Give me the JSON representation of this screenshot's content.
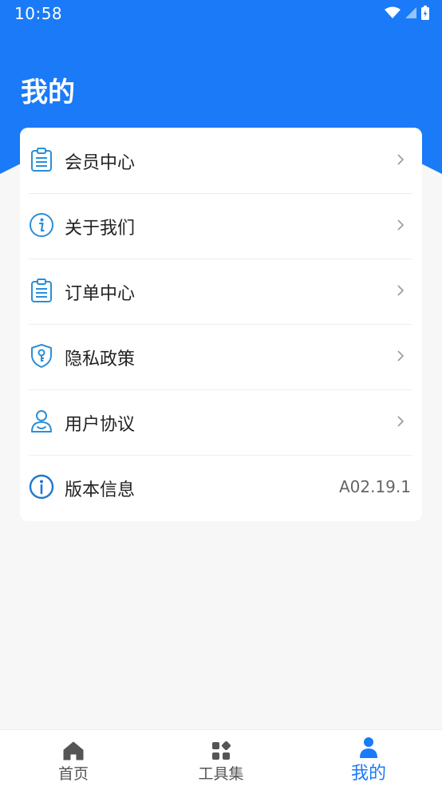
{
  "status_bar": {
    "time": "10:58"
  },
  "page": {
    "title": "我的"
  },
  "menu": {
    "items": [
      {
        "label": "会员中心",
        "icon": "clipboard-icon"
      },
      {
        "label": "关于我们",
        "icon": "info-icon"
      },
      {
        "label": "订单中心",
        "icon": "clipboard-icon"
      },
      {
        "label": "隐私政策",
        "icon": "shield-key-icon"
      },
      {
        "label": "用户协议",
        "icon": "user-icon"
      }
    ],
    "version": {
      "label": "版本信息",
      "value": "A02.19.1",
      "icon": "info-icon"
    }
  },
  "bottom_nav": {
    "items": [
      {
        "label": "首页",
        "icon": "home-icon"
      },
      {
        "label": "工具集",
        "icon": "grid-icon"
      },
      {
        "label": "我的",
        "icon": "person-icon",
        "active": true
      }
    ]
  },
  "colors": {
    "primary": "#1a7af8",
    "icon_blue": "#2a8fd8",
    "background": "#f7f7f8"
  }
}
